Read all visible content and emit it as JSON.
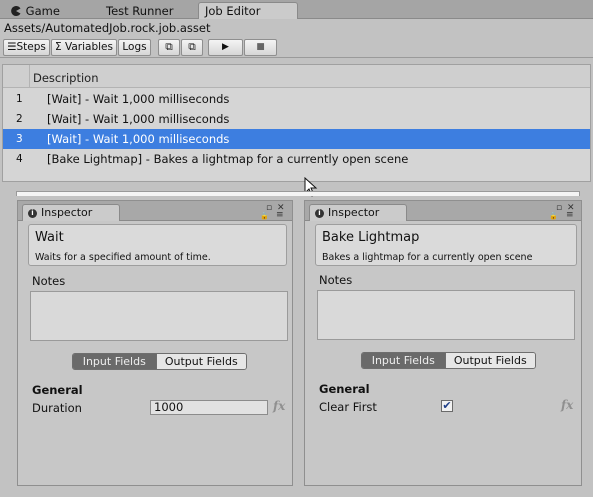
{
  "tabs": [
    {
      "label": "Game",
      "icon": "pacman-icon"
    },
    {
      "label": "Test Runner"
    },
    {
      "label": "Job Editor",
      "active": true
    }
  ],
  "path": "Assets/AutomatedJob.rock.job.asset",
  "toolbar": {
    "steps": "Steps",
    "variables": "Variables",
    "logs": "Logs",
    "list_glyph": "☰",
    "sigma_glyph": "Σ",
    "play_glyph": "▶",
    "stop_glyph": "■",
    "copy_glyph": "⧉",
    "paste_glyph": "⧉"
  },
  "steps_list": {
    "header": "Description",
    "rows": [
      {
        "num": "1",
        "text": "[Wait] - Wait 1,000 milliseconds"
      },
      {
        "num": "2",
        "text": "[Wait] - Wait 1,000 milliseconds"
      },
      {
        "num": "3",
        "text": "[Wait] - Wait 1,000 milliseconds",
        "selected": true
      },
      {
        "num": "4",
        "text": "[Bake Lightmap] - Bakes a lightmap for a currently open scene"
      }
    ]
  },
  "inspectors": [
    {
      "tab": "Inspector",
      "title": "Wait",
      "description": "Waits for a specified amount of time.",
      "notes_label": "Notes",
      "input_tab": "Input Fields",
      "output_tab": "Output Fields",
      "group": "General",
      "field_label": "Duration",
      "field_value": "1000",
      "fx": "fx"
    },
    {
      "tab": "Inspector",
      "title": "Bake Lightmap",
      "description": "Bakes a lightmap for a currently open scene",
      "notes_label": "Notes",
      "input_tab": "Input Fields",
      "output_tab": "Output Fields",
      "group": "General",
      "field_label": "Clear First",
      "field_checked": true,
      "check_glyph": "✔",
      "fx": "fx"
    }
  ],
  "panel_controls": {
    "maximize": "▫",
    "close": "✕",
    "lock": "🔒",
    "menu": "≡"
  },
  "colors": {
    "selection": "#3d7ee0",
    "segment_on": "#6a6a6a"
  }
}
